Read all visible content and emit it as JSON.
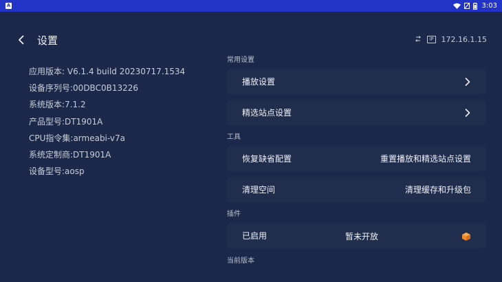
{
  "status_bar": {
    "app_badge": "A",
    "time": "3:03",
    "icons": [
      "wifi-icon",
      "signal-off-icon",
      "battery-icon"
    ]
  },
  "header": {
    "title": "设置",
    "ip": "172.16.1.15",
    "ip_label": "IP"
  },
  "info": [
    "应用版本: V6.1.4 build 20230717.1534",
    "设备序列号:00DBC0B13226",
    "系统版本:7.1.2",
    "产品型号:DT1901A",
    "CPU指令集:armeabi-v7a",
    "系统定制商:DT1901A",
    "设备型号:aosp"
  ],
  "sections": {
    "common": "常用设置",
    "tools": "工具",
    "plugins": "插件",
    "current_version": "当前版本"
  },
  "cards": {
    "playback": {
      "label": "播放设置"
    },
    "site": {
      "label": "精选站点设置"
    },
    "restore": {
      "label": "恢复缺省配置",
      "value": "重置播放和精选站点设置"
    },
    "clean": {
      "label": "清理空间",
      "value": "清理缓存和升级包"
    },
    "plugin": {
      "label": "已启用",
      "value": "暂未开放"
    }
  },
  "colors": {
    "background": "#1b2849",
    "status_bar": "#2233c8",
    "card": "#212d4c",
    "cube_accent": "#f08a2c"
  }
}
